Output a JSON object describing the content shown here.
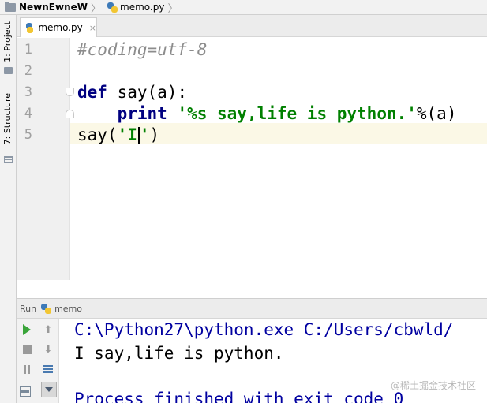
{
  "breadcrumb": {
    "project": "NewnEwneW",
    "file": "memo.py"
  },
  "left_strip": {
    "project_tab": "1: Project",
    "structure_tab": "7: Structure"
  },
  "editor_tab": {
    "label": "memo.py",
    "close": "×"
  },
  "editor": {
    "line_numbers": [
      "1",
      "2",
      "3",
      "4",
      "5"
    ],
    "current_line": "5",
    "code": {
      "line1_comment": "#coding=utf-8",
      "line3_kw": "def",
      "line3_rest": " say(a):",
      "line4_indent": "    ",
      "line4_kw": "print",
      "line4_sp": " ",
      "line4_str": "'%s say,life is python.'",
      "line4_rest": "%(a)",
      "line5_start": "say(",
      "line5_str_a": "'I",
      "line5_str_b": "'",
      "line5_end": ")"
    }
  },
  "run_panel": {
    "label": "Run",
    "config": "memo",
    "console": {
      "command": "C:\\Python27\\python.exe C:/Users/cbwld/",
      "output": "I say,life is python.",
      "exit": "Process finished with exit code 0"
    }
  },
  "icons": {
    "run": "play-icon",
    "stop": "stop-icon",
    "pause": "pause-icon",
    "up": "arrow-up-icon",
    "down": "arrow-down-icon",
    "wrap": "soft-wrap-icon",
    "scroll_end": "scroll-to-end-icon",
    "layout": "layout-icon"
  },
  "watermark": "@稀土掘金技术社区"
}
